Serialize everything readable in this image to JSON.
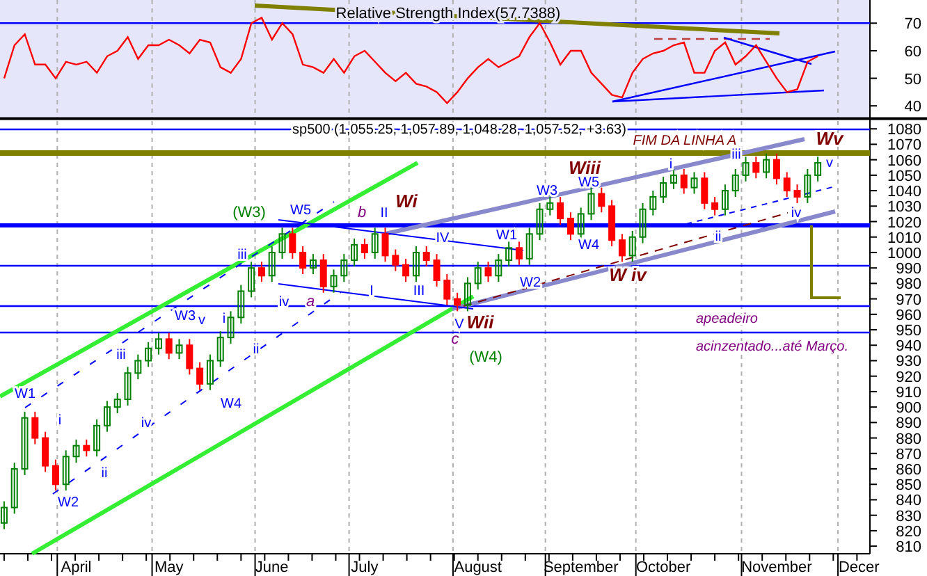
{
  "rsi_panel": {
    "chart_data": {
      "type": "line",
      "title": "Relative Strength Index(57.7388)",
      "ylim": [
        35.5,
        78.4
      ],
      "yticks": [
        40,
        50,
        60,
        70
      ],
      "series": [
        {
          "color": "#ff0000",
          "values": [
            50,
            62,
            66,
            55,
            55,
            50,
            56,
            55,
            56,
            52,
            58,
            60,
            65,
            57,
            62,
            62,
            64,
            62,
            59,
            64,
            63,
            54,
            52,
            57,
            70,
            72,
            64,
            70,
            66,
            55,
            54,
            52,
            57,
            52,
            58,
            60,
            56,
            52,
            49,
            52,
            48,
            47,
            45,
            41,
            45,
            50,
            54,
            57,
            54,
            56,
            58,
            65,
            70,
            63,
            55,
            60,
            60,
            52,
            48,
            44,
            43,
            52,
            57,
            59,
            60,
            62,
            63,
            52,
            52,
            60,
            63,
            55,
            58,
            62,
            56,
            50,
            45,
            46,
            56,
            58
          ]
        }
      ]
    }
  },
  "price_panel": {
    "chart_data": {
      "type": "candlestick",
      "title": "sp500 (1,055.25, 1,057.89, 1,048.28, 1,057.52, +3.63)",
      "ylim": [
        806,
        1086.4
      ],
      "yticks": [
        810,
        820,
        830,
        840,
        850,
        860,
        870,
        880,
        890,
        900,
        910,
        920,
        930,
        940,
        950,
        960,
        970,
        980,
        990,
        1000,
        1010,
        1020,
        1030,
        1040,
        1050,
        1060,
        1070,
        1080
      ],
      "categories": [
        null,
        null,
        null,
        null,
        null,
        null,
        null,
        "April",
        null,
        null,
        null,
        null,
        null,
        null,
        null,
        null,
        "May",
        null,
        null,
        null,
        null,
        null,
        null,
        null,
        null,
        null,
        "June",
        null,
        null,
        null,
        null,
        null,
        null,
        null,
        null,
        "July",
        null,
        null,
        null,
        null,
        null,
        null,
        null,
        null,
        null,
        null,
        "August",
        null,
        null,
        null,
        null,
        null,
        null,
        null,
        null,
        null,
        "September",
        null,
        null,
        null,
        null,
        null,
        null,
        null,
        "October",
        null,
        null,
        null,
        null,
        null,
        null,
        null,
        null,
        null,
        null,
        "November",
        null,
        null,
        null,
        null,
        null,
        null,
        null,
        "Decer"
      ],
      "ohlc": [
        [
          825,
          839,
          821,
          835
        ],
        [
          835,
          864,
          831,
          860
        ],
        [
          860,
          897,
          856,
          893
        ],
        [
          893,
          897,
          876,
          880
        ],
        [
          880,
          884,
          858,
          862
        ],
        [
          862,
          866,
          846,
          850
        ],
        [
          850,
          872,
          846,
          868
        ],
        [
          868,
          879,
          864,
          875
        ],
        [
          875,
          879,
          868,
          872
        ],
        [
          872,
          892,
          868,
          888
        ],
        [
          888,
          904,
          884,
          900
        ],
        [
          900,
          909,
          896,
          905
        ],
        [
          905,
          926,
          901,
          922
        ],
        [
          922,
          934,
          918,
          930
        ],
        [
          930,
          942,
          926,
          938
        ],
        [
          938,
          948,
          934,
          944
        ],
        [
          944,
          948,
          931,
          935
        ],
        [
          935,
          944,
          931,
          940
        ],
        [
          940,
          944,
          921,
          925
        ],
        [
          925,
          929,
          911,
          915
        ],
        [
          915,
          934,
          911,
          930
        ],
        [
          930,
          949,
          926,
          945
        ],
        [
          945,
          962,
          941,
          958
        ],
        [
          958,
          979,
          954,
          975
        ],
        [
          975,
          994,
          971,
          990
        ],
        [
          990,
          994,
          981,
          985
        ],
        [
          985,
          1004,
          981,
          1000
        ],
        [
          1000,
          1016,
          996,
          1012
        ],
        [
          1012,
          1016,
          996,
          1000
        ],
        [
          1000,
          1004,
          986,
          990
        ],
        [
          990,
          999,
          986,
          995
        ],
        [
          995,
          999,
          974,
          978
        ],
        [
          978,
          989,
          974,
          985
        ],
        [
          985,
          999,
          981,
          995
        ],
        [
          995,
          1009,
          991,
          1005
        ],
        [
          1005,
          1009,
          996,
          1000
        ],
        [
          1000,
          1016,
          996,
          1012
        ],
        [
          1012,
          1016,
          994,
          998
        ],
        [
          998,
          1002,
          988,
          992
        ],
        [
          992,
          996,
          981,
          985
        ],
        [
          985,
          1004,
          981,
          1000
        ],
        [
          1000,
          1004,
          991,
          995
        ],
        [
          995,
          999,
          978,
          982
        ],
        [
          982,
          986,
          966,
          970
        ],
        [
          970,
          974,
          962,
          966
        ],
        [
          966,
          984,
          962,
          980
        ],
        [
          980,
          994,
          976,
          990
        ],
        [
          990,
          994,
          981,
          985
        ],
        [
          985,
          999,
          981,
          995
        ],
        [
          995,
          1007,
          991,
          1003
        ],
        [
          1003,
          1007,
          992,
          996
        ],
        [
          996,
          1016,
          992,
          1012
        ],
        [
          1012,
          1032,
          1008,
          1028
        ],
        [
          1028,
          1036,
          1024,
          1032
        ],
        [
          1032,
          1036,
          1018,
          1022
        ],
        [
          1022,
          1026,
          1008,
          1012
        ],
        [
          1012,
          1029,
          1008,
          1025
        ],
        [
          1025,
          1042,
          1021,
          1038
        ],
        [
          1038,
          1042,
          1026,
          1030
        ],
        [
          1030,
          1034,
          1004,
          1008
        ],
        [
          1008,
          1012,
          994,
          998
        ],
        [
          998,
          1014,
          994,
          1010
        ],
        [
          1010,
          1032,
          1006,
          1028
        ],
        [
          1028,
          1040,
          1024,
          1036
        ],
        [
          1036,
          1049,
          1032,
          1045
        ],
        [
          1045,
          1054,
          1041,
          1050
        ],
        [
          1050,
          1054,
          1038,
          1042
        ],
        [
          1042,
          1052,
          1038,
          1048
        ],
        [
          1048,
          1052,
          1028,
          1032
        ],
        [
          1032,
          1036,
          1024,
          1028
        ],
        [
          1028,
          1044,
          1024,
          1040
        ],
        [
          1040,
          1054,
          1036,
          1050
        ],
        [
          1050,
          1062,
          1046,
          1058
        ],
        [
          1058,
          1062,
          1048,
          1052
        ],
        [
          1052,
          1064,
          1048,
          1060
        ],
        [
          1060,
          1064,
          1044,
          1048
        ],
        [
          1048,
          1052,
          1036,
          1040
        ],
        [
          1040,
          1044,
          1032,
          1036
        ],
        [
          1036,
          1054,
          1032,
          1050
        ],
        [
          1050,
          1062,
          1046,
          1058
        ],
        null,
        null,
        null,
        null
      ]
    },
    "wave_labels": [
      {
        "text": "FIM DA LINHA A",
        "kind": "heading"
      },
      {
        "text": "Wv",
        "kind": "major"
      },
      {
        "text": "Wi",
        "kind": "major"
      },
      {
        "text": "Wiii",
        "kind": "major"
      },
      {
        "text": "W iv",
        "kind": "major"
      },
      {
        "text": "Wii",
        "kind": "major"
      },
      {
        "text": "(W3)",
        "kind": "primary"
      },
      {
        "text": "(W4)",
        "kind": "primary"
      },
      {
        "text": "a",
        "kind": "correction"
      },
      {
        "text": "b",
        "kind": "correction"
      },
      {
        "text": "c",
        "kind": "correction"
      },
      {
        "text": "W1",
        "kind": "minor"
      },
      {
        "text": "W2",
        "kind": "minor"
      },
      {
        "text": "i",
        "kind": "minor"
      },
      {
        "text": "ii",
        "kind": "minor"
      },
      {
        "text": "iii",
        "kind": "minor"
      },
      {
        "text": "iv",
        "kind": "minor"
      },
      {
        "text": "W3",
        "kind": "minor"
      },
      {
        "text": "v",
        "kind": "minor"
      },
      {
        "text": "i",
        "kind": "minor"
      },
      {
        "text": "ii",
        "kind": "minor"
      },
      {
        "text": "iii",
        "kind": "minor"
      },
      {
        "text": "iv",
        "kind": "minor"
      },
      {
        "text": "W5",
        "kind": "minor"
      },
      {
        "text": "W4",
        "kind": "minor"
      },
      {
        "text": "I",
        "kind": "minor"
      },
      {
        "text": "II",
        "kind": "minor"
      },
      {
        "text": "III",
        "kind": "minor"
      },
      {
        "text": "IV",
        "kind": "minor"
      },
      {
        "text": "V",
        "kind": "minor"
      },
      {
        "text": "W1",
        "kind": "minor"
      },
      {
        "text": "W2",
        "kind": "minor"
      },
      {
        "text": "W3",
        "kind": "minor"
      },
      {
        "text": "W5",
        "kind": "minor"
      },
      {
        "text": "W4",
        "kind": "minor"
      },
      {
        "text": "i",
        "kind": "minor"
      },
      {
        "text": "iii",
        "kind": "minor"
      },
      {
        "text": "ii",
        "kind": "minor"
      },
      {
        "text": "iv",
        "kind": "minor"
      },
      {
        "text": "v",
        "kind": "minor"
      },
      {
        "text": "apeadeiro\nacinzentado...até Março.",
        "kind": "note"
      }
    ]
  }
}
